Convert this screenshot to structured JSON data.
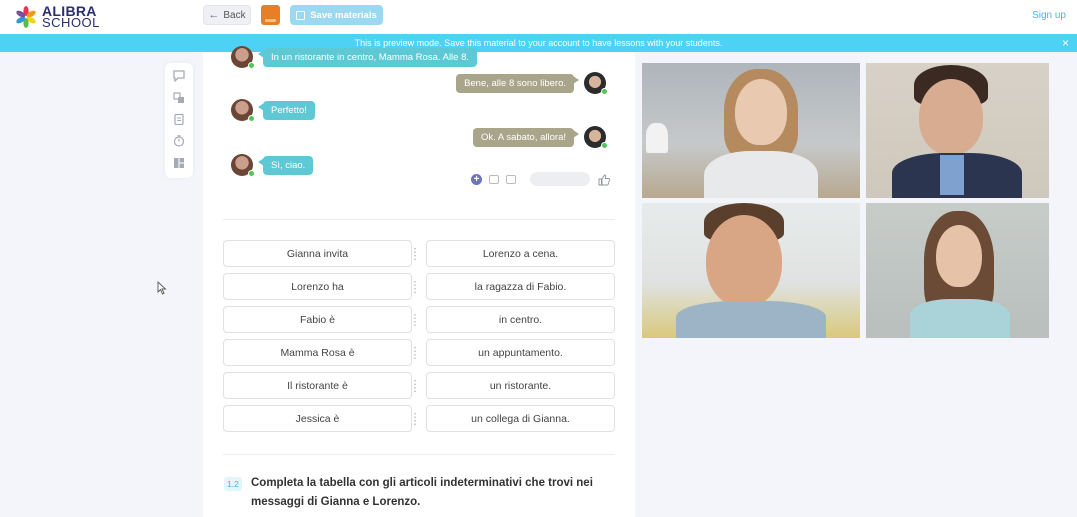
{
  "header": {
    "logo_line1": "ALIBRA",
    "logo_line2": "SCHOOL",
    "back_label": "Back",
    "save_label": "Save materials",
    "signup_label": "Sign up"
  },
  "banner": {
    "text": "This is preview mode. Save this material to your account to have lessons with your students.",
    "close": "×"
  },
  "chat": {
    "messages": [
      {
        "side": "left",
        "text": "In un ristorante in centro, Mamma Rosa. Alle 8."
      },
      {
        "side": "right",
        "text": "Bene, alle 8 sono libero."
      },
      {
        "side": "left",
        "text": "Perfetto!"
      },
      {
        "side": "right",
        "text": "Ok. A sabato, allora!"
      },
      {
        "side": "left",
        "text": "Sì, ciao."
      }
    ]
  },
  "matching": {
    "left": [
      "Gianna invita",
      "Lorenzo ha",
      "Fabio è",
      "Mamma Rosa è",
      "Il ristorante è",
      "Jessica è"
    ],
    "right": [
      "Lorenzo a cena.",
      "la ragazza di Fabio.",
      "in centro.",
      "un appuntamento.",
      "un ristorante.",
      "un collega di Gianna."
    ]
  },
  "exercise": {
    "number": "1.2",
    "instruction": "Completa la tabella con gli articoli indeterminativi che trovi nei messaggi di Gianna e Lorenzo."
  },
  "colors": {
    "banner": "#4dd2f5",
    "teal_bubble": "#5ec9d4",
    "olive_bubble": "#a9a58a",
    "accent": "#43b6e3",
    "online": "#4fc657"
  },
  "icons": [
    "chat-icon",
    "translate-icon",
    "clipboard-icon",
    "timer-icon",
    "layout-icon",
    "plus-icon",
    "camera-icon",
    "image-icon",
    "like-icon"
  ]
}
